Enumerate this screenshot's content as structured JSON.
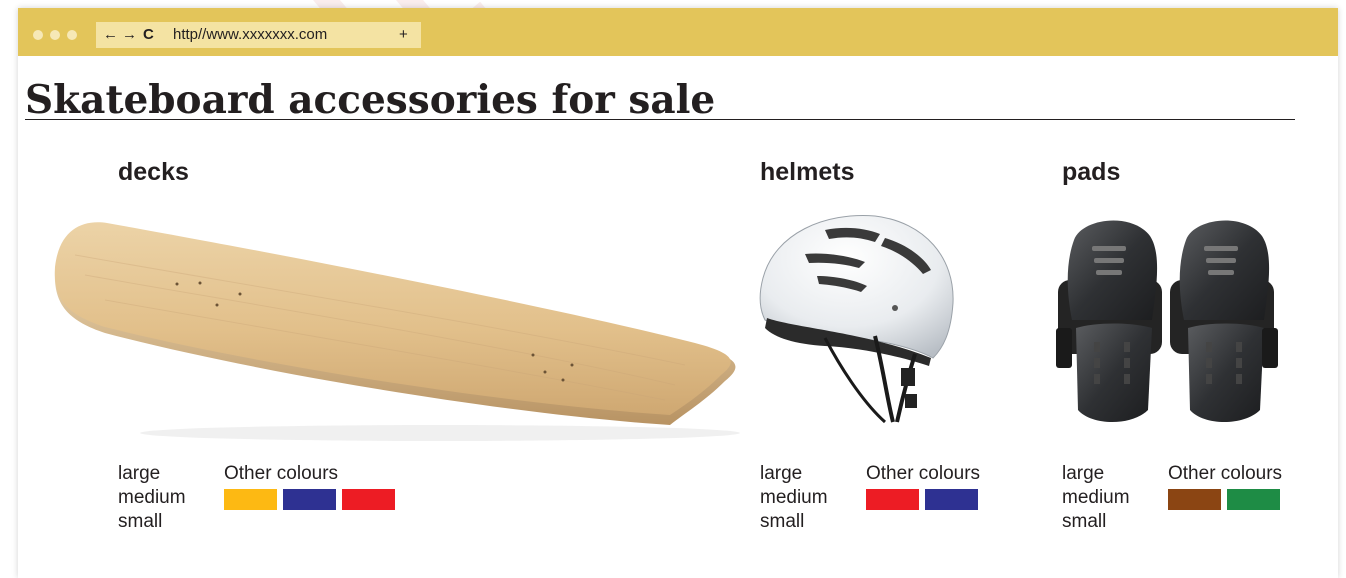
{
  "browser": {
    "url": "http//www.xxxxxxx.com",
    "nav_back": "←",
    "nav_forward": "→",
    "nav_reload": "C",
    "new_tab": "+"
  },
  "page": {
    "title": "Skateboard accessories for sale",
    "watermark": "unit"
  },
  "products": [
    {
      "name": "decks",
      "sizes": [
        "large",
        "medium",
        "small"
      ],
      "other_colours_label": "Other colours",
      "swatches": [
        "#fdb913",
        "#2e3192",
        "#ed1c24"
      ]
    },
    {
      "name": "helmets",
      "sizes": [
        "large",
        "medium",
        "small"
      ],
      "other_colours_label": "Other colours",
      "swatches": [
        "#ed1c24",
        "#2e3192"
      ]
    },
    {
      "name": "pads",
      "sizes": [
        "large",
        "medium",
        "small"
      ],
      "other_colours_label": "Other colours",
      "swatches": [
        "#8b4513",
        "#1e8c45"
      ]
    }
  ]
}
